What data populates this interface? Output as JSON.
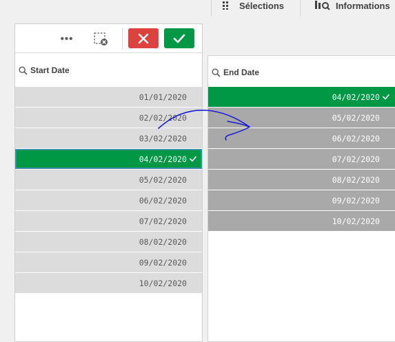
{
  "toolbar": {
    "selections_label": "Sélections",
    "informations_label": "Informations"
  },
  "start_listbox": {
    "title": "Start Date",
    "rows": [
      {
        "value": "01/01/2020",
        "state": "possible"
      },
      {
        "value": "02/02/2020",
        "state": "possible"
      },
      {
        "value": "03/02/2020",
        "state": "possible"
      },
      {
        "value": "04/02/2020",
        "state": "selected"
      },
      {
        "value": "05/02/2020",
        "state": "possible"
      },
      {
        "value": "06/02/2020",
        "state": "possible"
      },
      {
        "value": "07/02/2020",
        "state": "possible"
      },
      {
        "value": "08/02/2020",
        "state": "possible"
      },
      {
        "value": "09/02/2020",
        "state": "possible"
      },
      {
        "value": "10/02/2020",
        "state": "possible"
      }
    ]
  },
  "end_listbox": {
    "title": "End Date",
    "rows": [
      {
        "value": "04/02/2020",
        "state": "selected"
      },
      {
        "value": "05/02/2020",
        "state": "alternative"
      },
      {
        "value": "06/02/2020",
        "state": "alternative"
      },
      {
        "value": "07/02/2020",
        "state": "alternative"
      },
      {
        "value": "08/02/2020",
        "state": "alternative"
      },
      {
        "value": "09/02/2020",
        "state": "alternative"
      },
      {
        "value": "10/02/2020",
        "state": "alternative"
      }
    ]
  },
  "colors": {
    "selected": "#009845",
    "possible": "#dcdcdc",
    "alternative": "#a9a9a9",
    "cancel": "#dc423e",
    "annotation": "#1a1ad6"
  },
  "icons": {
    "more": "more-icon",
    "clear_selections": "clear-selections-icon",
    "cancel": "close-icon",
    "confirm": "check-icon",
    "search": "search-icon",
    "selections": "selections-grid-icon",
    "informations": "insights-icon"
  }
}
